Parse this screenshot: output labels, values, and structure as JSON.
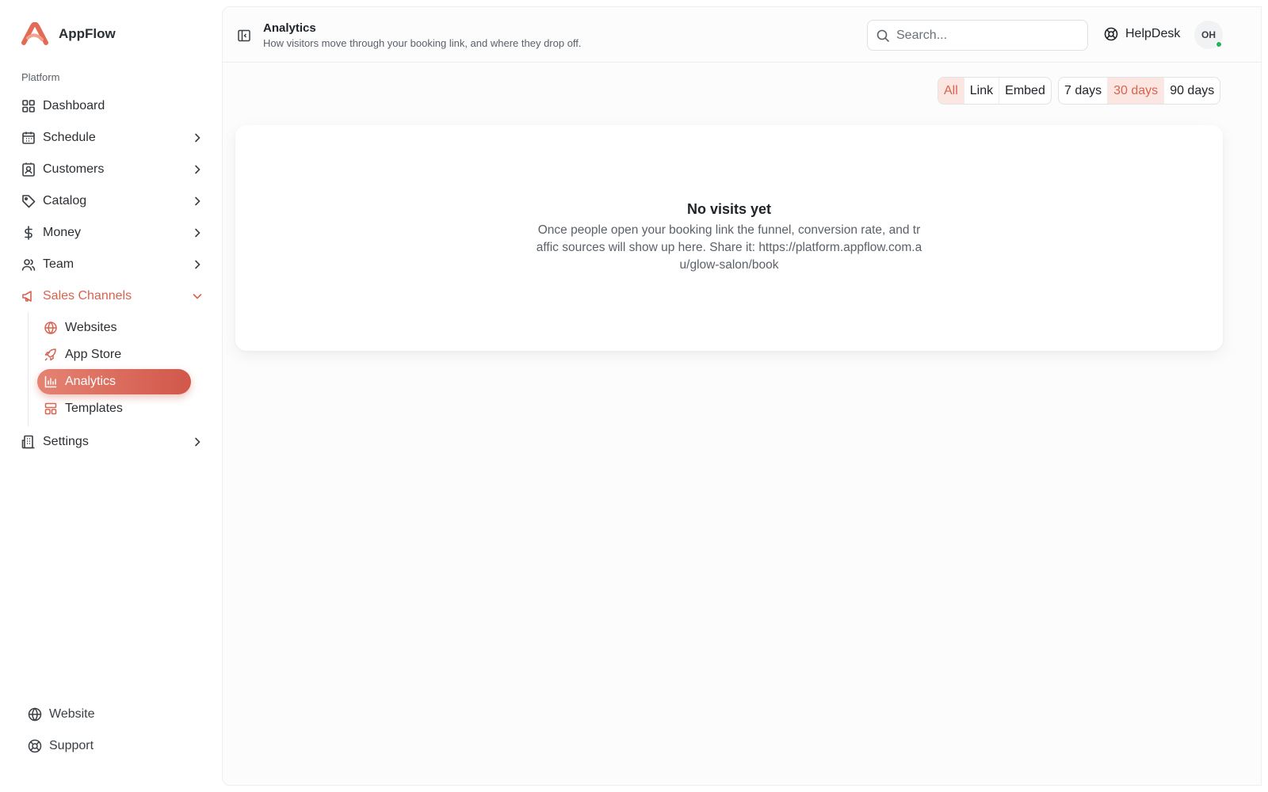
{
  "brand": {
    "name": "AppFlow",
    "logo_icon": "appflow-logo",
    "accent": "#d9624f"
  },
  "sidebar": {
    "section_label": "Platform",
    "items": [
      {
        "label": "Dashboard",
        "icon": "grid-icon",
        "has_chevron": false
      },
      {
        "label": "Schedule",
        "icon": "calendar-icon",
        "has_chevron": true
      },
      {
        "label": "Customers",
        "icon": "contact-icon",
        "has_chevron": true
      },
      {
        "label": "Catalog",
        "icon": "tag-icon",
        "has_chevron": true
      },
      {
        "label": "Money",
        "icon": "dollar-icon",
        "has_chevron": true
      },
      {
        "label": "Team",
        "icon": "users-icon",
        "has_chevron": true
      },
      {
        "label": "Sales Channels",
        "icon": "megaphone-icon",
        "expanded": true
      },
      {
        "label": "Settings",
        "icon": "building-icon",
        "has_chevron": true
      }
    ],
    "sub_items": [
      {
        "label": "Websites",
        "icon": "globe-icon"
      },
      {
        "label": "App Store",
        "icon": "rocket-icon"
      },
      {
        "label": "Analytics",
        "icon": "bar-chart-icon",
        "active": true
      },
      {
        "label": "Templates",
        "icon": "layout-icon"
      }
    ],
    "footer": [
      {
        "label": "Website",
        "icon": "globe-icon"
      },
      {
        "label": "Support",
        "icon": "lifebuoy-icon"
      }
    ]
  },
  "header": {
    "title": "Analytics",
    "subtitle": "How visitors move through your booking link, and where they drop off.",
    "search_placeholder": "Search...",
    "helpdesk_label": "HelpDesk",
    "avatar_initials": "OH",
    "online_status_color": "#22b45a"
  },
  "filters": {
    "source": {
      "options": [
        "All",
        "Link",
        "Embed"
      ],
      "selected": "All"
    },
    "range": {
      "options": [
        "7 days",
        "30 days",
        "90 days"
      ],
      "selected": "30 days"
    }
  },
  "empty_state": {
    "title": "No visits yet",
    "description": "Once people open your booking link the funnel, conversion rate, and traffic sources will show up here. Share it: https://platform.appflow.com.au/glow-salon/book"
  }
}
